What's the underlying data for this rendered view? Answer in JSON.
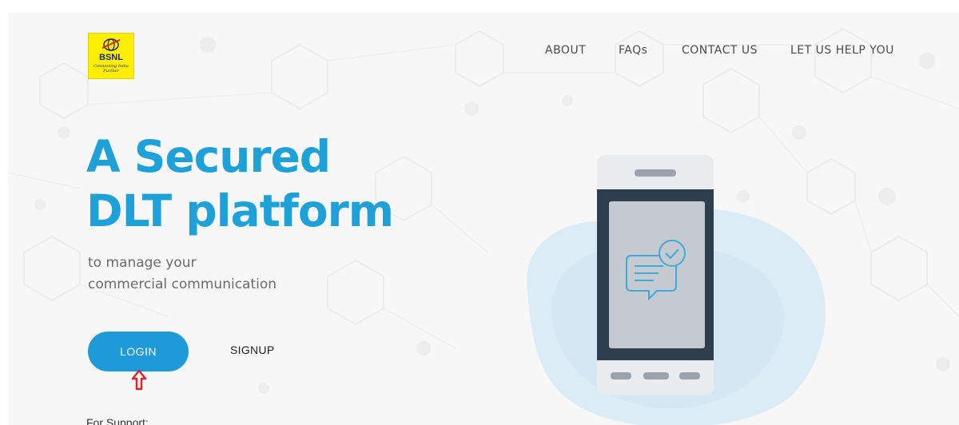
{
  "brand": {
    "logo_text": "BSNL",
    "logo_tagline": "Connecting India Further"
  },
  "nav": {
    "items": [
      "ABOUT",
      "FAQs",
      "CONTACT US",
      "LET US HELP YOU"
    ]
  },
  "hero": {
    "title_line1": "A Secured",
    "title_line2": "DLT platform",
    "subtitle_line1": "to manage your",
    "subtitle_line2": "commercial communication"
  },
  "actions": {
    "login_label": "LOGIN",
    "signup_label": "SIGNUP"
  },
  "support": {
    "label": "For Support:"
  },
  "colors": {
    "accent": "#1ea0d8",
    "button": "#1e9ad8",
    "logo_bg": "#ffee00",
    "arrow": "#d9262c",
    "phone_frame": "#2e3e4e"
  },
  "icons": [
    "chat-check-icon",
    "arrow-up-icon"
  ]
}
